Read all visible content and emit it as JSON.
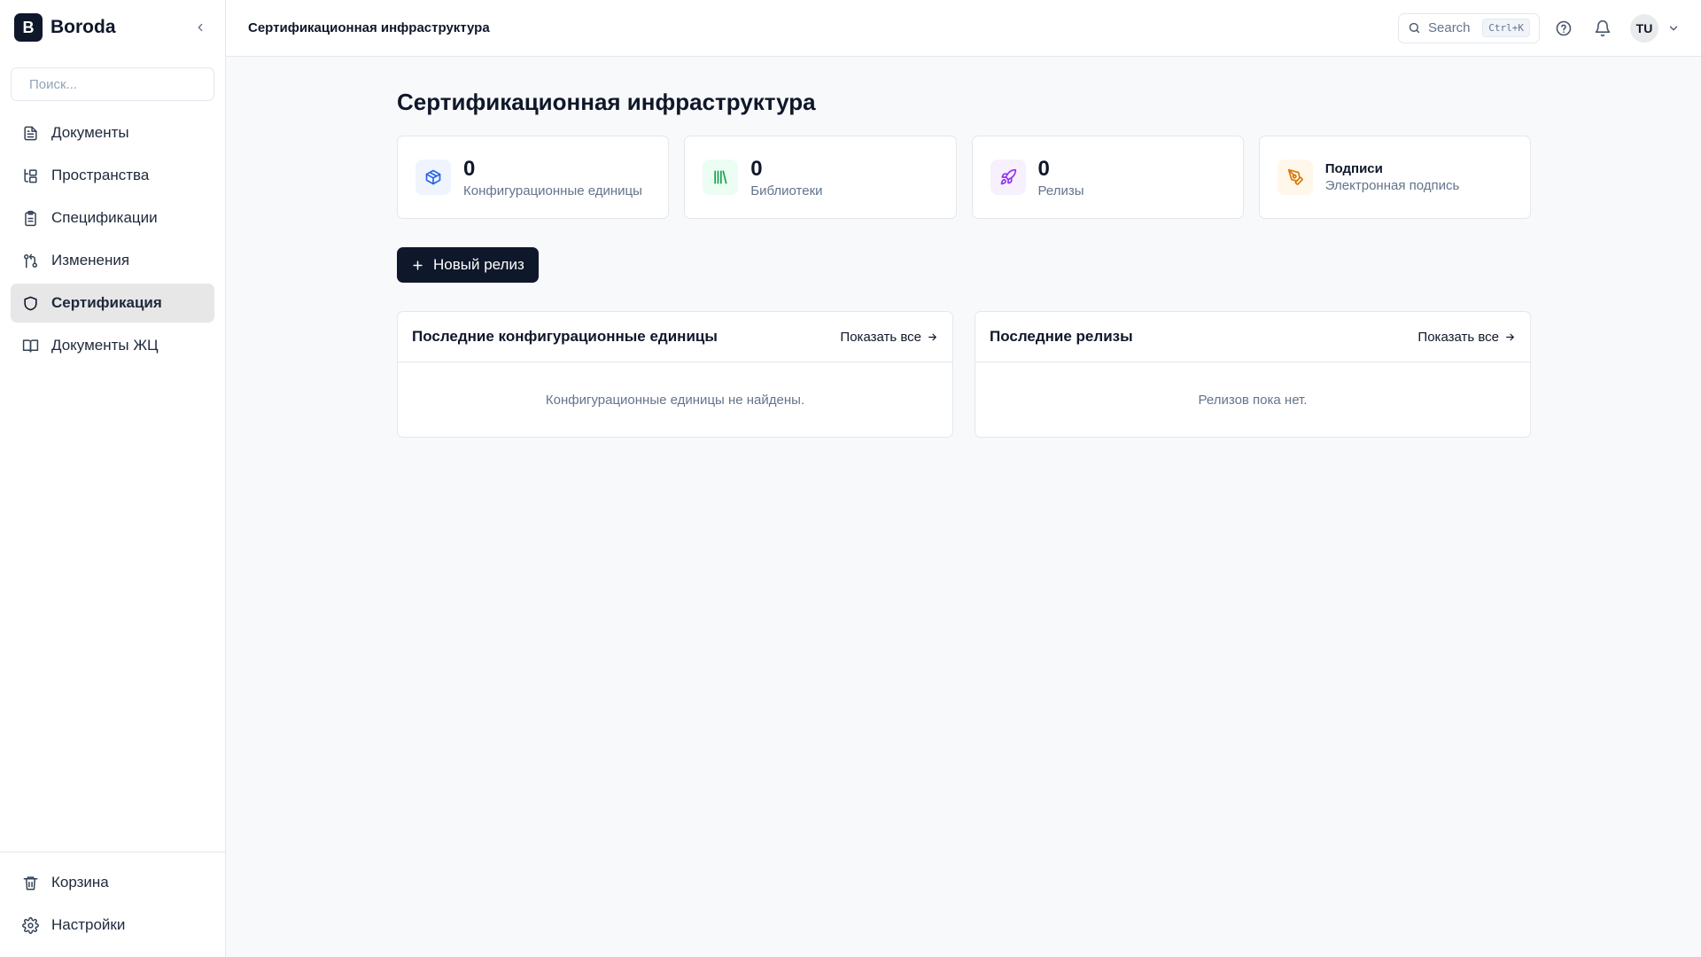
{
  "app": {
    "logo_letter": "B",
    "name": "Boroda"
  },
  "sidebar": {
    "search_placeholder": "Поиск...",
    "items": [
      {
        "label": "Документы",
        "icon": "file-text-icon"
      },
      {
        "label": "Пространства",
        "icon": "tree-icon"
      },
      {
        "label": "Спецификации",
        "icon": "clipboard-icon"
      },
      {
        "label": "Изменения",
        "icon": "git-pull-request-icon"
      },
      {
        "label": "Сертификация",
        "icon": "shield-icon",
        "active": true
      },
      {
        "label": "Документы ЖЦ",
        "icon": "book-icon"
      }
    ],
    "bottom": [
      {
        "label": "Корзина",
        "icon": "trash-icon"
      },
      {
        "label": "Настройки",
        "icon": "gear-icon"
      }
    ]
  },
  "topbar": {
    "title": "Сертификационная инфраструктура",
    "search_label": "Search",
    "search_shortcut": "Ctrl+K",
    "user_initials": "TU"
  },
  "page": {
    "title": "Сертификационная инфраструктура",
    "stats": [
      {
        "value": "0",
        "label": "Конфигурационные единицы",
        "icon": "box-icon",
        "color": "#2563eb",
        "bg": "#eff4ff"
      },
      {
        "value": "0",
        "label": "Библиотеки",
        "icon": "library-icon",
        "color": "#16a34a",
        "bg": "#ecfdf3"
      },
      {
        "value": "0",
        "label": "Релизы",
        "icon": "rocket-icon",
        "color": "#9333ea",
        "bg": "#f6f0ff"
      },
      {
        "title": "Подписи",
        "label": "Электронная подпись",
        "icon": "pen-tool-icon",
        "color": "#d97706",
        "bg": "#fff7ea"
      }
    ],
    "new_release_button": "Новый релиз",
    "panels": [
      {
        "title": "Последние конфигурационные единицы",
        "show_all": "Показать все",
        "empty": "Конфигурационные единицы не найдены."
      },
      {
        "title": "Последние релизы",
        "show_all": "Показать все",
        "empty": "Релизов пока нет."
      }
    ]
  }
}
